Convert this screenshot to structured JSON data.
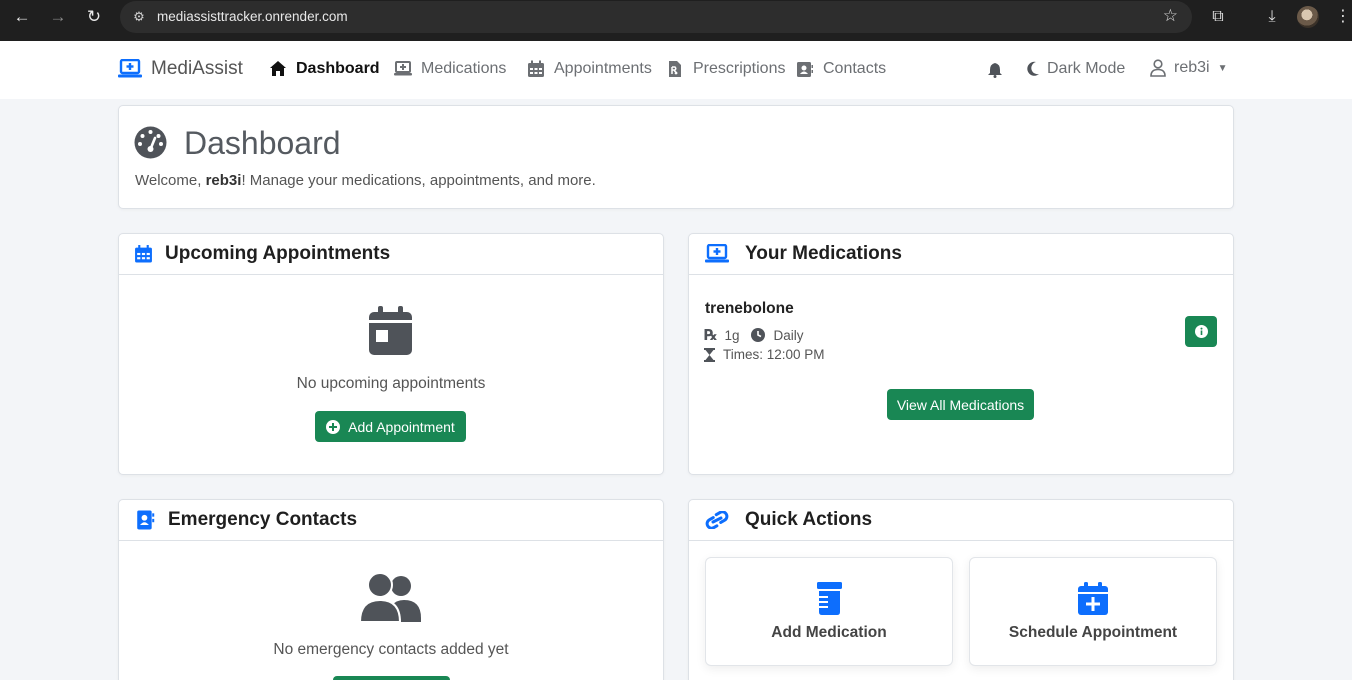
{
  "browser": {
    "url": "mediassisttracker.onrender.com"
  },
  "app": {
    "brand": "MediAssist",
    "nav": {
      "dashboard": "Dashboard",
      "medications": "Medications",
      "appointments": "Appointments",
      "prescriptions": "Prescriptions",
      "contacts": "Contacts"
    },
    "dark_mode": "Dark Mode",
    "username": "reb3i"
  },
  "dashboard": {
    "title": "Dashboard",
    "welcome_prefix": "Welcome, ",
    "welcome_user": "reb3i",
    "welcome_suffix": "! Manage your medications, appointments, and more."
  },
  "appointments_card": {
    "title": "Upcoming Appointments",
    "empty": "No upcoming appointments",
    "add_button": "Add Appointment"
  },
  "medications_card": {
    "title": "Your Medications",
    "items": [
      {
        "name": "trenebolone",
        "dose": "1g",
        "frequency": "Daily",
        "times": "Times: 12:00 PM"
      }
    ],
    "view_all": "View All Medications"
  },
  "contacts_card": {
    "title": "Emergency Contacts",
    "empty": "No emergency contacts added yet"
  },
  "quick_actions": {
    "title": "Quick Actions",
    "add_medication": "Add Medication",
    "schedule_appointment": "Schedule Appointment"
  },
  "colors": {
    "primary": "#0d6efd",
    "success": "#198754",
    "icon_dark": "#4f5359"
  }
}
